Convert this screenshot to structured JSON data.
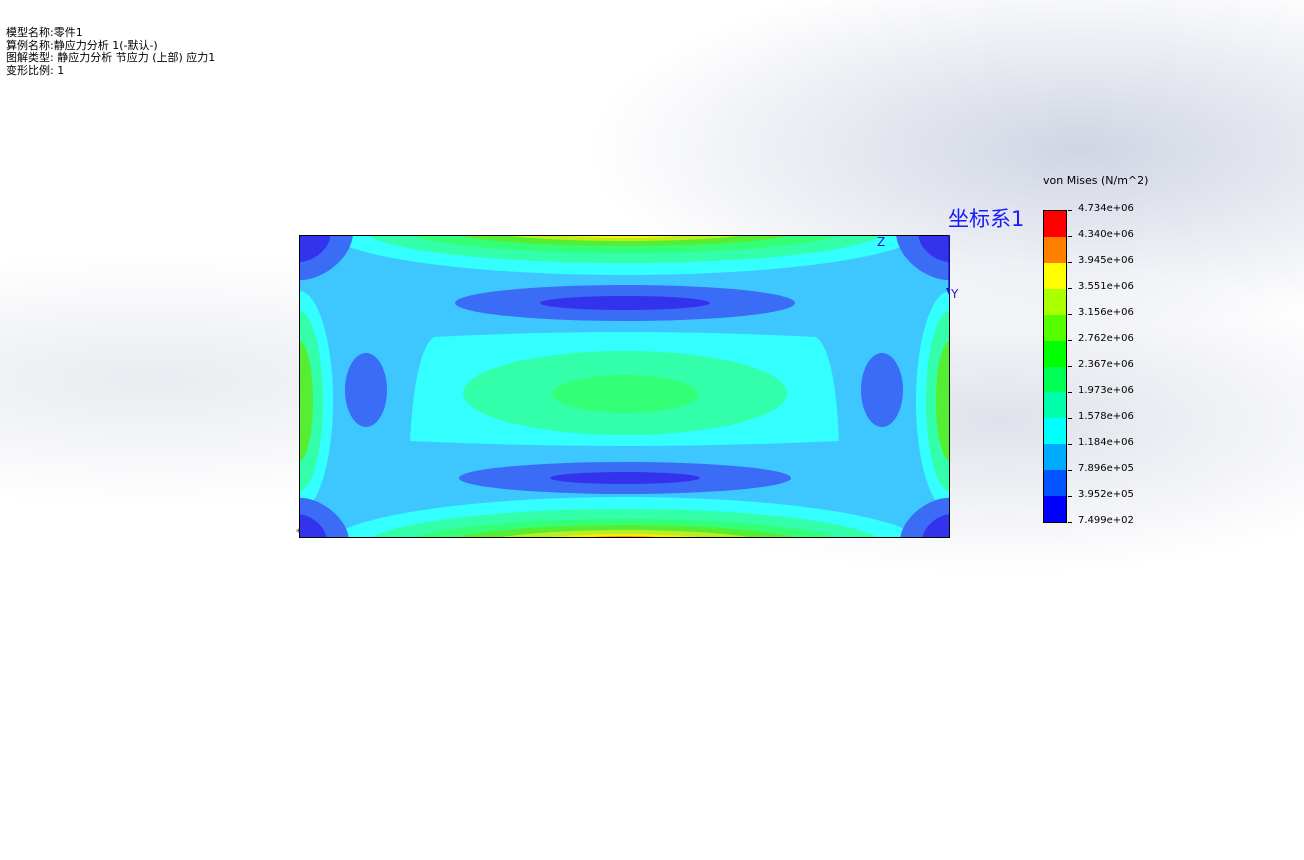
{
  "info": {
    "line1": "模型名称:零件1",
    "line2": "算例名称:静应力分析 1(-默认-)",
    "line3": "图解类型: 静应力分析 节应力 (上部) 应力1",
    "line4": "变形比例: 1"
  },
  "coordinate_system": {
    "label": "坐标系1",
    "axis_z": "Z",
    "axis_y": "Y",
    "origin_marker": "*"
  },
  "legend": {
    "title": "von Mises (N/m^2)",
    "labels": [
      "4.734e+06",
      "4.340e+06",
      "3.945e+06",
      "3.551e+06",
      "3.156e+06",
      "2.762e+06",
      "2.367e+06",
      "1.973e+06",
      "1.578e+06",
      "1.184e+06",
      "7.896e+05",
      "3.952e+05",
      "7.499e+02"
    ],
    "colors": [
      "#ff0000",
      "#ff7f00",
      "#ffff00",
      "#aaff00",
      "#55ff00",
      "#00ff00",
      "#00ff55",
      "#00ffaa",
      "#00ffff",
      "#00aaff",
      "#0055ff",
      "#0000ff"
    ]
  },
  "contour_colors": {
    "dark_blue": "#3333ee",
    "mid_blue": "#3b6cf5",
    "light_blue": "#3ec7ff",
    "cyan": "#33ffff",
    "aqua_green": "#33ffaa",
    "green": "#33ff77",
    "bright_green": "#55ee33",
    "yellow_green": "#bbee22",
    "yellow": "#ffee00",
    "orange": "#ff9900",
    "red": "#ff3300"
  }
}
